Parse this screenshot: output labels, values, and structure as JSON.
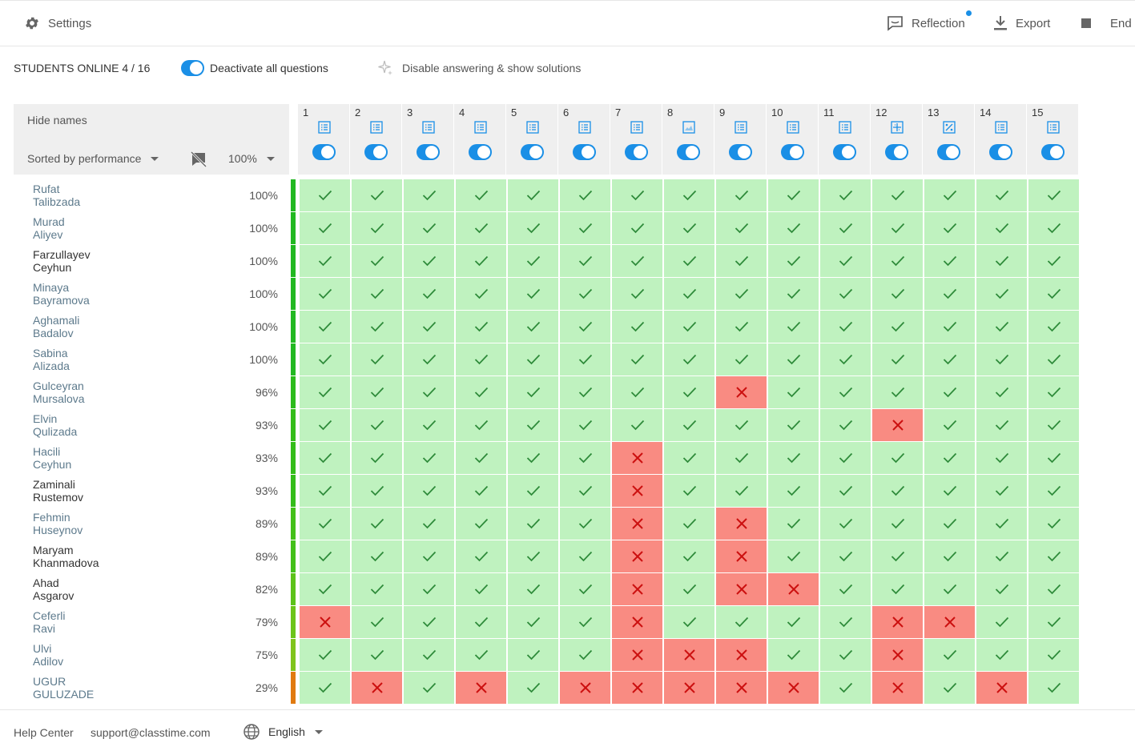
{
  "topbar": {
    "settings_label": "Settings",
    "reflection_label": "Reflection",
    "export_label": "Export",
    "end_label": "End"
  },
  "subbar": {
    "students_online": "STUDENTS ONLINE 4 / 16",
    "deactivate_label": "Deactivate all questions",
    "disable_label": "Disable answering & show solutions"
  },
  "grid_header": {
    "hide_names": "Hide names",
    "sort_label": "Sorted by performance",
    "percent_filter": "100%"
  },
  "questions": [
    {
      "num": "1",
      "icon": "list-icon"
    },
    {
      "num": "2",
      "icon": "list-icon"
    },
    {
      "num": "3",
      "icon": "list-icon"
    },
    {
      "num": "4",
      "icon": "list-icon"
    },
    {
      "num": "5",
      "icon": "list-icon"
    },
    {
      "num": "6",
      "icon": "list-icon"
    },
    {
      "num": "7",
      "icon": "list-icon"
    },
    {
      "num": "8",
      "icon": "image-icon"
    },
    {
      "num": "9",
      "icon": "list-icon"
    },
    {
      "num": "10",
      "icon": "list-icon"
    },
    {
      "num": "11",
      "icon": "list-icon"
    },
    {
      "num": "12",
      "icon": "table-icon"
    },
    {
      "num": "13",
      "icon": "fraction-icon"
    },
    {
      "num": "14",
      "icon": "list-icon"
    },
    {
      "num": "15",
      "icon": "list-icon"
    }
  ],
  "students": [
    {
      "name": "Rufat Talibzada",
      "pct": "100%",
      "online": false,
      "bar": "#22b822",
      "results": [
        1,
        1,
        1,
        1,
        1,
        1,
        1,
        1,
        1,
        1,
        1,
        1,
        1,
        1,
        1
      ]
    },
    {
      "name": "Murad Aliyev",
      "pct": "100%",
      "online": false,
      "bar": "#22b822",
      "results": [
        1,
        1,
        1,
        1,
        1,
        1,
        1,
        1,
        1,
        1,
        1,
        1,
        1,
        1,
        1
      ]
    },
    {
      "name": "Farzullayev Ceyhun",
      "pct": "100%",
      "online": true,
      "bar": "#22b822",
      "results": [
        1,
        1,
        1,
        1,
        1,
        1,
        1,
        1,
        1,
        1,
        1,
        1,
        1,
        1,
        1
      ]
    },
    {
      "name": "Minaya Bayramova",
      "pct": "100%",
      "online": false,
      "bar": "#22b822",
      "results": [
        1,
        1,
        1,
        1,
        1,
        1,
        1,
        1,
        1,
        1,
        1,
        1,
        1,
        1,
        1
      ]
    },
    {
      "name": "Aghamali Badalov",
      "pct": "100%",
      "online": false,
      "bar": "#22b822",
      "results": [
        1,
        1,
        1,
        1,
        1,
        1,
        1,
        1,
        1,
        1,
        1,
        1,
        1,
        1,
        1
      ]
    },
    {
      "name": "Sabina Alizada",
      "pct": "100%",
      "online": false,
      "bar": "#22b822",
      "results": [
        1,
        1,
        1,
        1,
        1,
        1,
        1,
        1,
        1,
        1,
        1,
        1,
        1,
        1,
        1
      ]
    },
    {
      "name": "Gulceyran Mursalova",
      "pct": "96%",
      "online": false,
      "bar": "#2cbb1c",
      "results": [
        1,
        1,
        1,
        1,
        1,
        1,
        1,
        1,
        0,
        1,
        1,
        1,
        1,
        1,
        1
      ]
    },
    {
      "name": "Elvin Qulizada",
      "pct": "93%",
      "online": false,
      "bar": "#34bd1a",
      "results": [
        1,
        1,
        1,
        1,
        1,
        1,
        1,
        1,
        1,
        1,
        1,
        0,
        1,
        1,
        1
      ]
    },
    {
      "name": "Hacili Ceyhun",
      "pct": "93%",
      "online": false,
      "bar": "#34bd1a",
      "results": [
        1,
        1,
        1,
        1,
        1,
        1,
        0,
        1,
        1,
        1,
        1,
        1,
        1,
        1,
        1
      ]
    },
    {
      "name": "Zaminali Rustemov",
      "pct": "93%",
      "online": true,
      "bar": "#34bd1a",
      "results": [
        1,
        1,
        1,
        1,
        1,
        1,
        0,
        1,
        1,
        1,
        1,
        1,
        1,
        1,
        1
      ]
    },
    {
      "name": "Fehmin Huseynov",
      "pct": "89%",
      "online": false,
      "bar": "#44c01a",
      "results": [
        1,
        1,
        1,
        1,
        1,
        1,
        0,
        1,
        0,
        1,
        1,
        1,
        1,
        1,
        1
      ]
    },
    {
      "name": "Maryam Khanmadova",
      "pct": "89%",
      "online": true,
      "bar": "#44c01a",
      "results": [
        1,
        1,
        1,
        1,
        1,
        1,
        0,
        1,
        0,
        1,
        1,
        1,
        1,
        1,
        1
      ]
    },
    {
      "name": "Ahad Asgarov",
      "pct": "82%",
      "online": true,
      "bar": "#5cc21a",
      "results": [
        1,
        1,
        1,
        1,
        1,
        1,
        0,
        1,
        0,
        0,
        1,
        1,
        1,
        1,
        1
      ]
    },
    {
      "name": "Ceferli Ravi",
      "pct": "79%",
      "online": false,
      "bar": "#6cc41a",
      "results": [
        0,
        1,
        1,
        1,
        1,
        1,
        0,
        1,
        1,
        1,
        1,
        0,
        0,
        1,
        1
      ]
    },
    {
      "name": "Ulvi Adilov",
      "pct": "75%",
      "online": false,
      "bar": "#80c41c",
      "results": [
        1,
        1,
        1,
        1,
        1,
        1,
        0,
        0,
        0,
        1,
        1,
        0,
        1,
        1,
        1
      ]
    },
    {
      "name": "UGUR GULUZADE",
      "pct": "29%",
      "online": false,
      "bar": "#e07a10",
      "results": [
        1,
        0,
        1,
        0,
        1,
        0,
        0,
        0,
        0,
        0,
        1,
        0,
        1,
        0,
        1
      ]
    }
  ],
  "footer": {
    "help_center": "Help Center",
    "support_email": "support@classtime.com",
    "language": "English"
  },
  "colors": {
    "correct": "#bff2bf",
    "incorrect": "#f98b82",
    "accent": "#1a8fe6"
  }
}
